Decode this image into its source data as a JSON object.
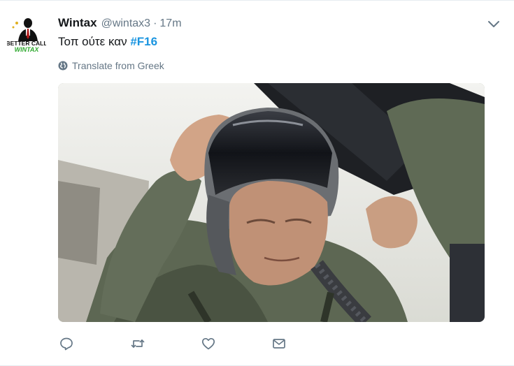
{
  "tweet": {
    "author_name": "Wintax",
    "author_handle": "@wintax3",
    "separator": "·",
    "timestamp": "17m",
    "text": "Τοπ ούτε καν",
    "hashtag": "#F16",
    "translate_label": "Translate from Greek",
    "avatar": {
      "line1": "BETTER CALL",
      "line2": "WINTAX"
    },
    "media_icon": "photo",
    "actions": [
      "reply-icon",
      "retweet-icon",
      "like-icon",
      "direct-message-icon"
    ]
  },
  "colors": {
    "link": "#1b95e0",
    "secondary_text": "#657786",
    "primary_text": "#14171a",
    "avatar_green": "#2ea82e"
  }
}
